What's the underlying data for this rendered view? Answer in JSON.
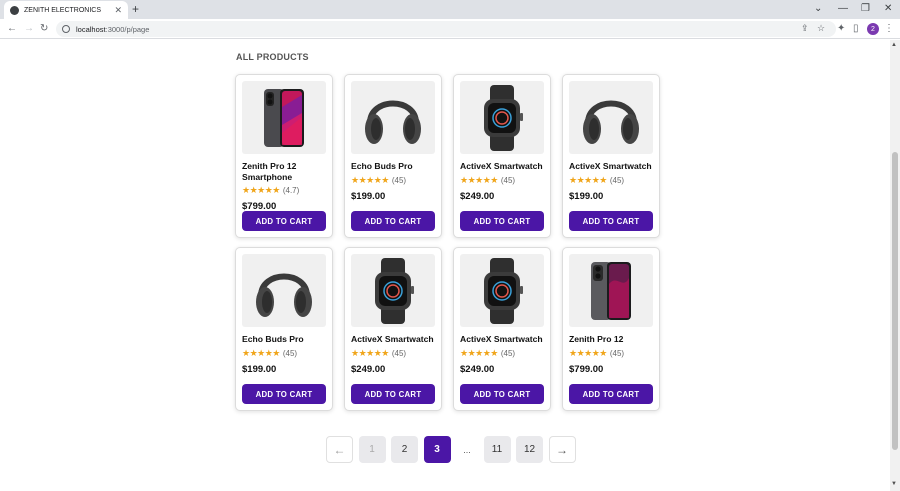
{
  "browser": {
    "tab_title": "ZENITH ELECTRONICS",
    "tab_close": "✕",
    "new_tab": "+",
    "url_host": "localhost",
    "url_rest": ":3000/p/page",
    "profile_initial": "2",
    "window_controls": [
      "⌄",
      "—",
      "❐",
      "✕"
    ]
  },
  "page": {
    "section_title": "ALL PRODUCTS"
  },
  "colors": {
    "accent": "#4b16a6",
    "star": "#f0a51a"
  },
  "products": [
    {
      "name": "Zenith Pro 12 Smartphone",
      "stars": "★★★★★",
      "reviews": "(4.7)",
      "price": "$799.00",
      "button": "ADD TO CART",
      "icon": "smartphone-pink"
    },
    {
      "name": "Echo Buds Pro",
      "stars": "★★★★★",
      "reviews": "(45)",
      "price": "$199.00",
      "button": "ADD TO CART",
      "icon": "headphones"
    },
    {
      "name": "ActiveX Smartwatch",
      "stars": "★★★★★",
      "reviews": "(45)",
      "price": "$249.00",
      "button": "ADD TO CART",
      "icon": "smartwatch"
    },
    {
      "name": "ActiveX Smartwatch",
      "stars": "★★★★★",
      "reviews": "(45)",
      "price": "$199.00",
      "button": "ADD TO CART",
      "icon": "headphones"
    },
    {
      "name": "Echo Buds Pro",
      "stars": "★★★★★",
      "reviews": "(45)",
      "price": "$199.00",
      "button": "ADD TO CART",
      "icon": "headphones"
    },
    {
      "name": "ActiveX Smartwatch",
      "stars": "★★★★★",
      "reviews": "(45)",
      "price": "$249.00",
      "button": "ADD TO CART",
      "icon": "smartwatch"
    },
    {
      "name": "ActiveX Smartwatch",
      "stars": "★★★★★",
      "reviews": "(45)",
      "price": "$249.00",
      "button": "ADD TO CART",
      "icon": "smartwatch"
    },
    {
      "name": "Zenith Pro 12",
      "stars": "★★★★★",
      "reviews": "(45)",
      "price": "$799.00",
      "button": "ADD TO CART",
      "icon": "smartphone-dark"
    }
  ],
  "pagination": {
    "prev": "←",
    "next": "→",
    "pages": [
      "1",
      "2",
      "3",
      "11",
      "12"
    ],
    "ellipsis": "...",
    "current": "3"
  }
}
